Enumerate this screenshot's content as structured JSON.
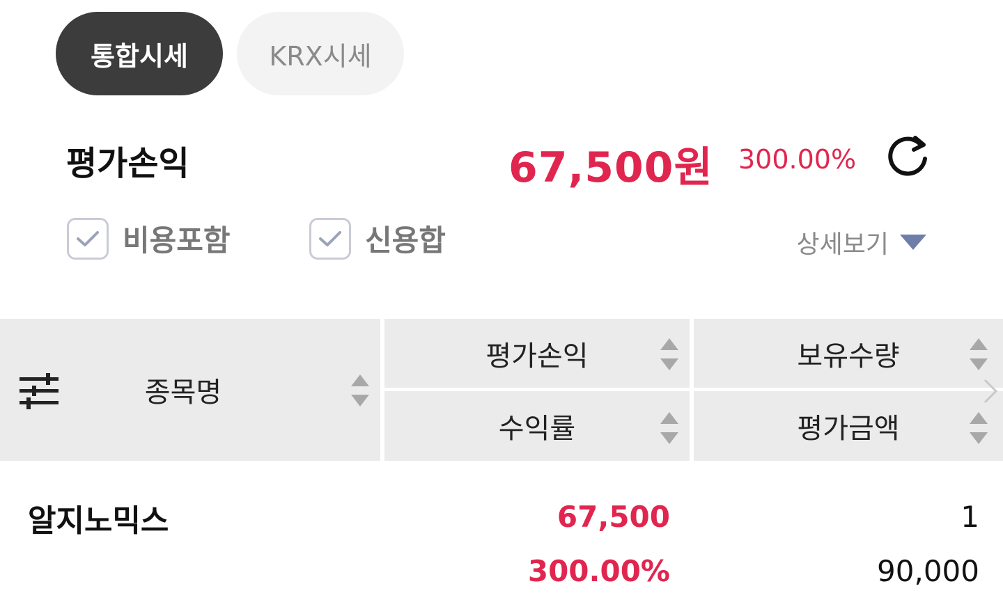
{
  "tabs": {
    "integrated": "통합시세",
    "krx": "KRX시세"
  },
  "summary": {
    "label": "평가손익",
    "profit": "67,500원",
    "rate": "300.00%"
  },
  "options": {
    "include_fee": "비용포함",
    "credit_sum": "신용합",
    "detail": "상세보기"
  },
  "table": {
    "headers": {
      "name": "종목명",
      "profit": "평가손익",
      "quantity": "보유수량",
      "rate": "수익률",
      "eval_amount": "평가금액"
    },
    "rows": [
      {
        "name": "알지노믹스",
        "profit": "67,500",
        "rate": "300.00%",
        "quantity": "1",
        "eval_amount": "90,000"
      }
    ]
  },
  "colors": {
    "accent_red": "#e0264f",
    "tab_active": "#3c3c3c",
    "header_bg": "#ebebeb"
  }
}
